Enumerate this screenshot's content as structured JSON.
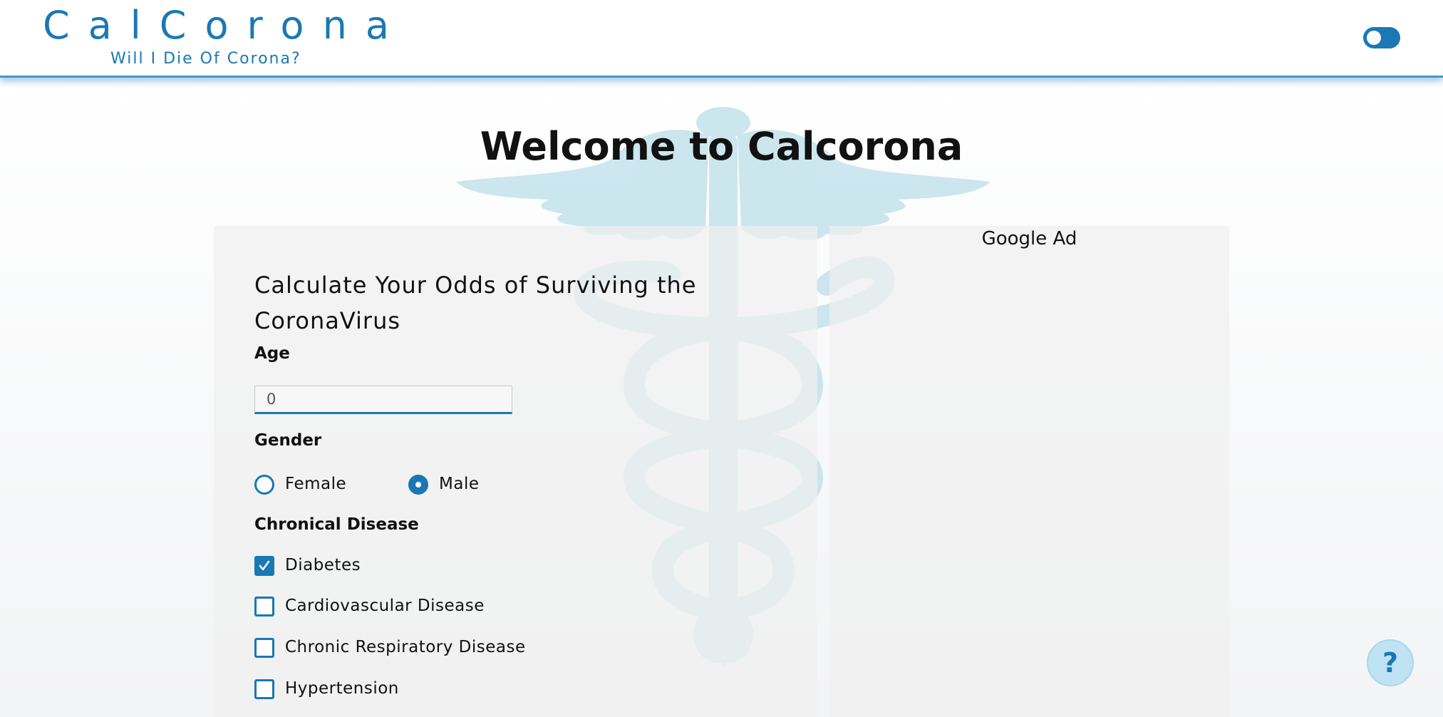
{
  "header": {
    "brand_title": "CalCorona",
    "brand_subtitle": "Will I Die Of Corona?"
  },
  "main": {
    "welcome": "Welcome to Calcorona"
  },
  "form": {
    "title": "Calculate Your Odds of Surviving the CoronaVirus",
    "age_label": "Age",
    "age_value": "0",
    "gender_label": "Gender",
    "gender_options": [
      "Female",
      "Male"
    ],
    "gender_selected": "Male",
    "disease_label": "Chronical Disease",
    "diseases": [
      {
        "label": "Diabetes",
        "checked": true
      },
      {
        "label": "Cardiovascular Disease",
        "checked": false
      },
      {
        "label": "Chronic Respiratory Disease",
        "checked": false
      },
      {
        "label": "Hypertension",
        "checked": false
      }
    ]
  },
  "ad": {
    "label": "Google Ad"
  },
  "help": {
    "label": "?"
  },
  "colors": {
    "accent": "#1a78b4",
    "panel": "#f0f0f0",
    "watermark": "#cbe6ef"
  },
  "icons": [
    "dark-mode-toggle",
    "caduceus-watermark",
    "checkmark-icon",
    "help-icon"
  ]
}
